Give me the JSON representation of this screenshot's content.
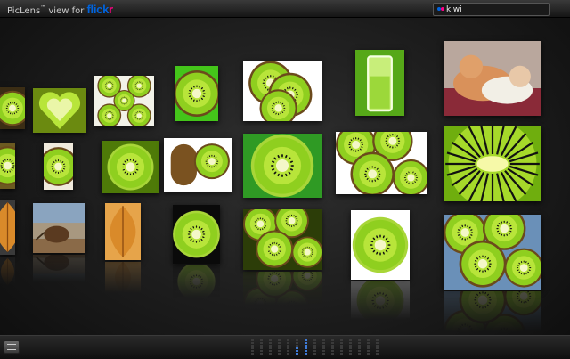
{
  "header": {
    "brand_name": "PicLens",
    "trademark": "™",
    "view_for_text": " view for ",
    "flickr_part1": "flick",
    "flickr_part2": "r"
  },
  "search": {
    "value": "kiwi"
  },
  "colors": {
    "flickr_blue": "#0063dc",
    "flickr_pink": "#ff0084",
    "scrubber_active": "#3f7bd8"
  },
  "icons": {
    "menu": "menu-icon",
    "search_logo": "flickr-dots-icon"
  },
  "wall": {
    "description_only": false,
    "rows": 3,
    "tiles": [
      {
        "name": "photo-kiwi-half",
        "kind": "half",
        "bg": "#3b2d14"
      },
      {
        "name": "photo-kiwi-heart",
        "kind": "heart",
        "bg": "#6b8a10"
      },
      {
        "name": "photo-kiwi-slices-grid",
        "kind": "grid",
        "bg": "#f2f2e8"
      },
      {
        "name": "photo-kiwi-green-bg",
        "kind": "half",
        "bg": "#44c51a"
      },
      {
        "name": "photo-kiwi-stack",
        "kind": "stack",
        "bg": "#ffffff"
      },
      {
        "name": "photo-kiwi-juice-glass",
        "kind": "glass",
        "bg": "#56a818"
      },
      {
        "name": "photo-kittens",
        "kind": "cats",
        "bg": "#b9a79d"
      },
      {
        "name": "photo-kiwi-edge-2",
        "kind": "half",
        "bg": "#6b5a20"
      },
      {
        "name": "photo-kiwi-pieces",
        "kind": "half",
        "bg": "#f0eadc"
      },
      {
        "name": "photo-kiwi-macro-core",
        "kind": "slice",
        "bg": "#4e7a08"
      },
      {
        "name": "photo-kiwi-halves-white",
        "kind": "halves",
        "bg": "#ffffff"
      },
      {
        "name": "photo-kiwi-on-green",
        "kind": "slice",
        "bg": "#2f9a24"
      },
      {
        "name": "photo-kiwi-slices-white",
        "kind": "slices",
        "bg": "#ffffff"
      },
      {
        "name": "photo-kiwi-macro-large",
        "kind": "macro",
        "bg": "#3a5a04"
      },
      {
        "name": "photo-kiwi-edge-3",
        "kind": "leaf",
        "bg": "#3a3a3a"
      },
      {
        "name": "photo-kiwi-bird",
        "kind": "bird",
        "bg": "#8aa4bf"
      },
      {
        "name": "photo-kiwi-leaf",
        "kind": "leaf",
        "bg": "#e6a44a"
      },
      {
        "name": "photo-kiwi-slice-dark",
        "kind": "slice",
        "bg": "#0a0a0a"
      },
      {
        "name": "photo-kiwi-slices-overlap",
        "kind": "slices",
        "bg": "#2c3d08"
      },
      {
        "name": "photo-kiwi-slice-white",
        "kind": "slice",
        "bg": "#ffffff"
      },
      {
        "name": "photo-kiwi-flowers",
        "kind": "slices",
        "bg": "#6a90b8"
      }
    ]
  },
  "scrubber": {
    "total_cells": 90,
    "active_cells": [
      33,
      34,
      35,
      36,
      37,
      38,
      39,
      40,
      41
    ]
  }
}
